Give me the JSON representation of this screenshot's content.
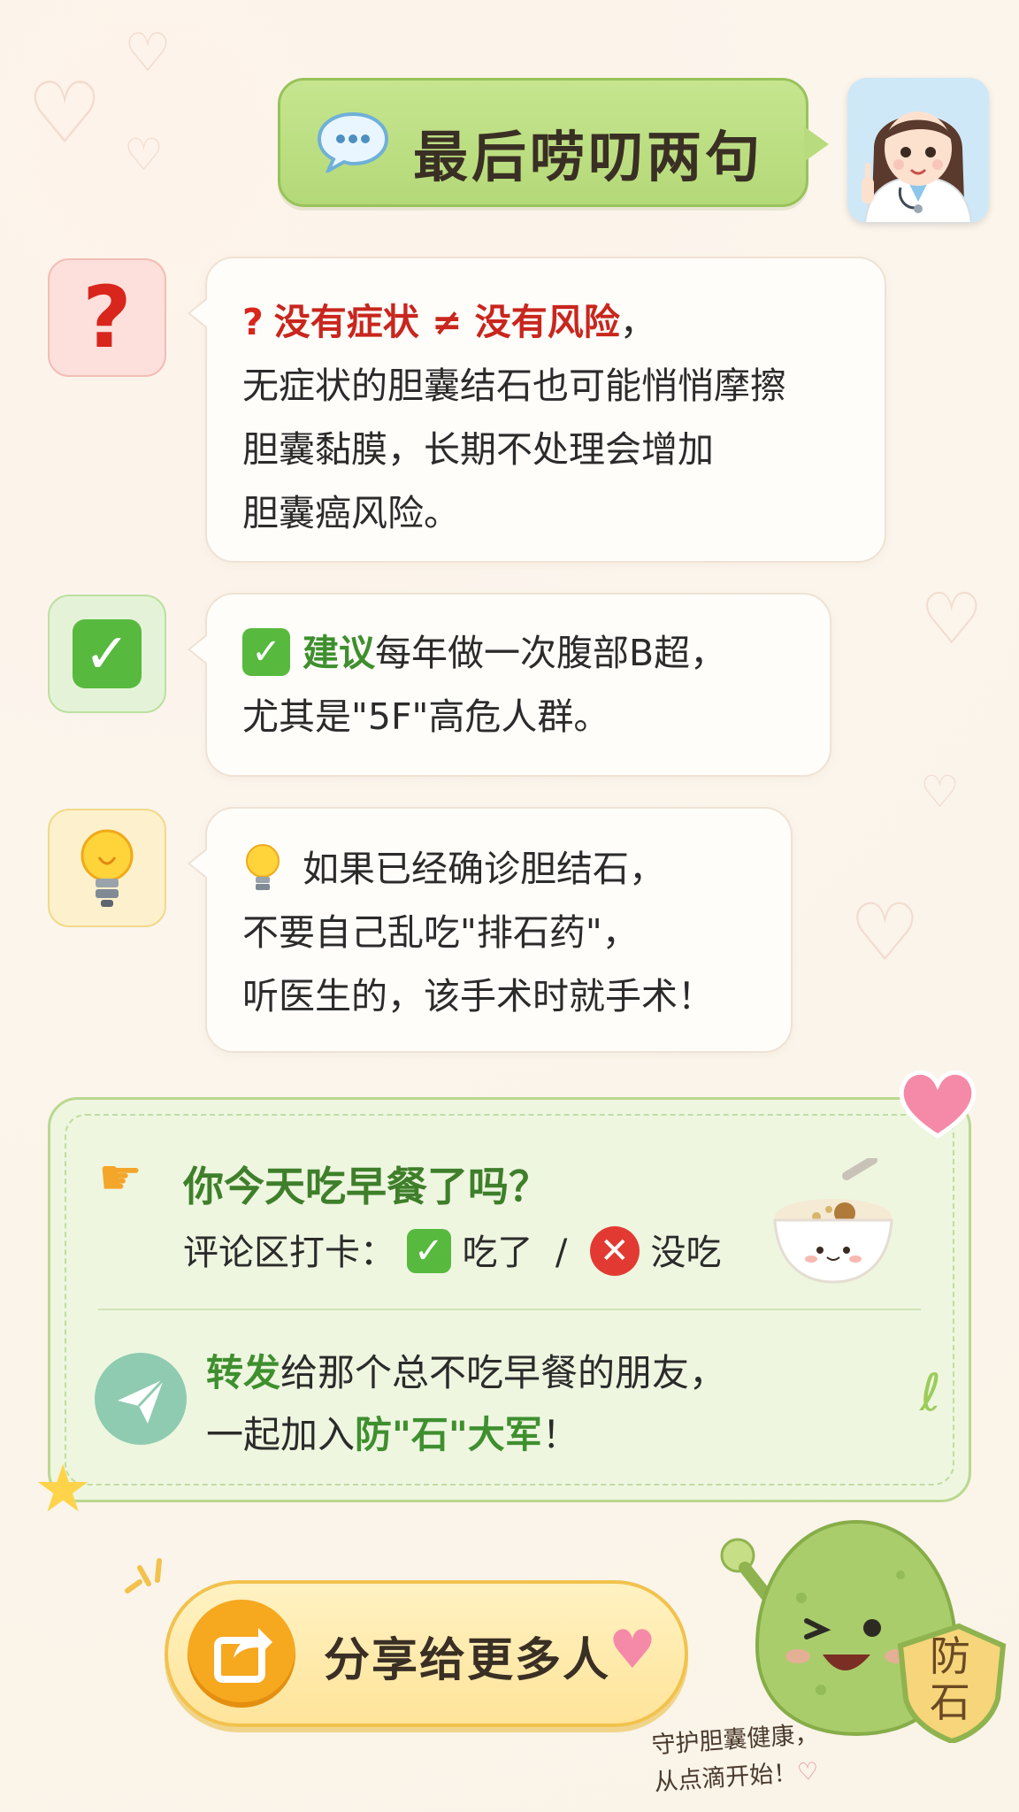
{
  "header": {
    "title": "最后唠叨两句"
  },
  "messages": [
    {
      "icon": "question-mark-icon",
      "headline": "没有症状 ≠ 没有风险",
      "headline_tail": "，",
      "lines": [
        "无症状的胆囊结石也可能悄悄摩擦",
        "胆囊黏膜，长期不处理会增加",
        "胆囊癌风险。"
      ]
    },
    {
      "icon": "check-mark-icon",
      "headline": "建议",
      "line1_rest": "每年做一次腹部B超，",
      "line2": "尤其是\"5F\"高危人群。"
    },
    {
      "icon": "light-bulb-icon",
      "line1": "如果已经确诊胆结石，",
      "line2": "不要自己乱吃\"排石药\"，",
      "line3": "听医生的，该手术时就手术！"
    }
  ],
  "engagement": {
    "question": "你今天吃早餐了吗？",
    "checkin_label": "评论区打卡：",
    "option_yes": "吃了",
    "separator": "/",
    "option_no": "没吃",
    "forward_highlight": "转发",
    "forward_rest": "给那个总不吃早餐的朋友，",
    "join_prefix": "一起加入",
    "join_highlight": "防\"石\"大军",
    "join_suffix": "！"
  },
  "share": {
    "label": "分享给更多人"
  },
  "mascot": {
    "shield_text": "防石"
  },
  "slogan": {
    "line1": "守护胆囊健康，",
    "line2": "从点滴开始！"
  },
  "colors": {
    "title_green": "#b4d978",
    "accent_red": "#c8261e",
    "accent_green": "#3f8f2f",
    "share_yellow": "#ffe49a"
  }
}
